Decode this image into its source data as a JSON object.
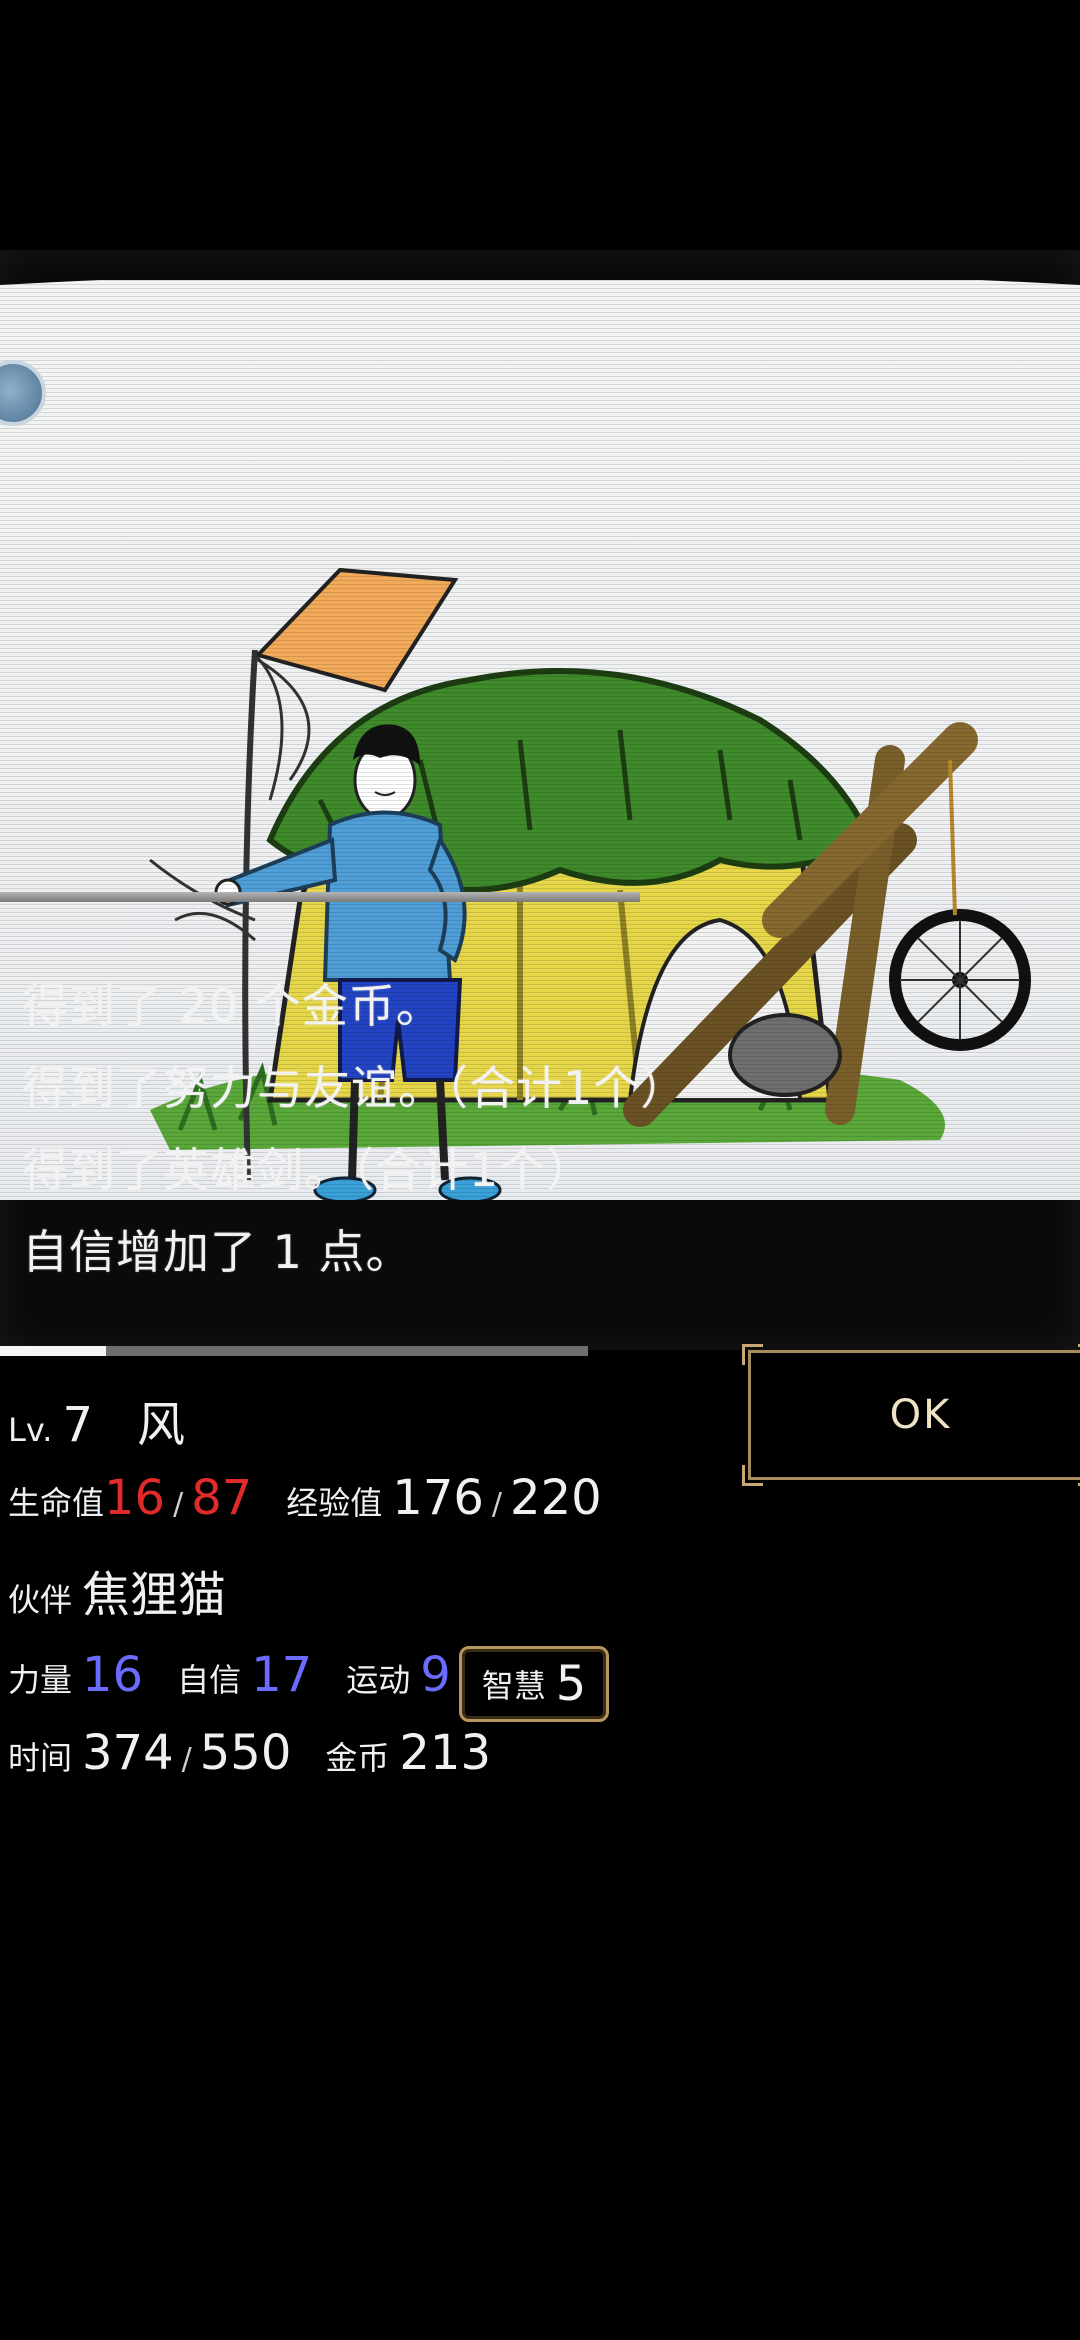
{
  "scene": {
    "edge_button_icon": "round-scene-badge-icon"
  },
  "log": {
    "lines": [
      "得到了 20 个金币。",
      "得到了努力与友谊。（合计1个）",
      "得到了英雄剑。（合计1个）",
      "自信增加了 1 点。"
    ]
  },
  "progress": {
    "fill_fraction": 0.18
  },
  "ok_button": {
    "label": "OK"
  },
  "stats": {
    "level_label": "Lv.",
    "level_value": "7",
    "name": "风",
    "hp_label": "生命值",
    "hp_current": "16",
    "hp_max": "87",
    "exp_label": "经验值",
    "exp_current": "176",
    "exp_max": "220",
    "partner_label": "伙伴",
    "partner_name": "焦狸猫",
    "strength_label": "力量",
    "strength_value": "16",
    "confidence_label": "自信",
    "confidence_value": "17",
    "sport_label": "运动",
    "sport_value": "9",
    "wisdom_label": "智慧",
    "wisdom_value": "5",
    "time_label": "时间",
    "time_current": "374",
    "time_max": "550",
    "gold_label": "金币",
    "gold_value": "213",
    "slash": "/"
  },
  "colors": {
    "hp": "#e12a2a",
    "stat_value": "#6b6bff",
    "gold_border": "#b89660"
  }
}
